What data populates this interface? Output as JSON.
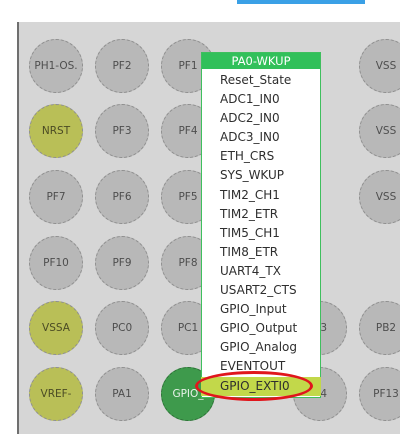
{
  "pins": [
    {
      "id": "ph1-os",
      "label": "PH1-OS."
    },
    {
      "id": "pf2",
      "label": "PF2"
    },
    {
      "id": "pf1",
      "label": "PF1"
    },
    {
      "id": "vss-1",
      "label": "VSS"
    },
    {
      "id": "nrst",
      "label": "NRST"
    },
    {
      "id": "pf3",
      "label": "PF3"
    },
    {
      "id": "pf4",
      "label": "PF4"
    },
    {
      "id": "vss-2",
      "label": "VSS"
    },
    {
      "id": "pf7",
      "label": "PF7"
    },
    {
      "id": "pf6",
      "label": "PF6"
    },
    {
      "id": "pf5",
      "label": "PF5"
    },
    {
      "id": "vss-3",
      "label": "VSS"
    },
    {
      "id": "pf10",
      "label": "PF10"
    },
    {
      "id": "pf9",
      "label": "PF9"
    },
    {
      "id": "pf8",
      "label": "PF8"
    },
    {
      "id": "vssa",
      "label": "VSSA"
    },
    {
      "id": "pc0",
      "label": "PC0"
    },
    {
      "id": "pc1",
      "label": "PC1"
    },
    {
      "id": "pc3",
      "label": "C3"
    },
    {
      "id": "pb2",
      "label": "PB2"
    },
    {
      "id": "vref",
      "label": "VREF-"
    },
    {
      "id": "pa1",
      "label": "PA1"
    },
    {
      "id": "gpio-pa0",
      "label": "GPIO_"
    },
    {
      "id": "pc4",
      "label": "C4"
    },
    {
      "id": "pf13",
      "label": "PF13"
    }
  ],
  "dropdown": {
    "header": "PA0-WKUP",
    "items": [
      "Reset_State",
      "ADC1_IN0",
      "ADC2_IN0",
      "ADC3_IN0",
      "ETH_CRS",
      "SYS_WKUP",
      "TIM2_CH1",
      "TIM2_ETR",
      "TIM5_CH1",
      "TIM8_ETR",
      "UART4_TX",
      "USART2_CTS",
      "GPIO_Input",
      "GPIO_Output",
      "GPIO_Analog",
      "EVENTOUT",
      "GPIO_EXTI0"
    ],
    "selected": "GPIO_EXTI0"
  },
  "colors": {
    "panel": "#d6d6d6",
    "pin_default": "#b8b8b8",
    "pin_power": "#b9bf57",
    "pin_active": "#3e9a4c",
    "menu_header": "#31c05a",
    "menu_selected": "#c2d84a",
    "annotation_ring": "#e0161c",
    "top_accent": "#3aa0e6"
  }
}
